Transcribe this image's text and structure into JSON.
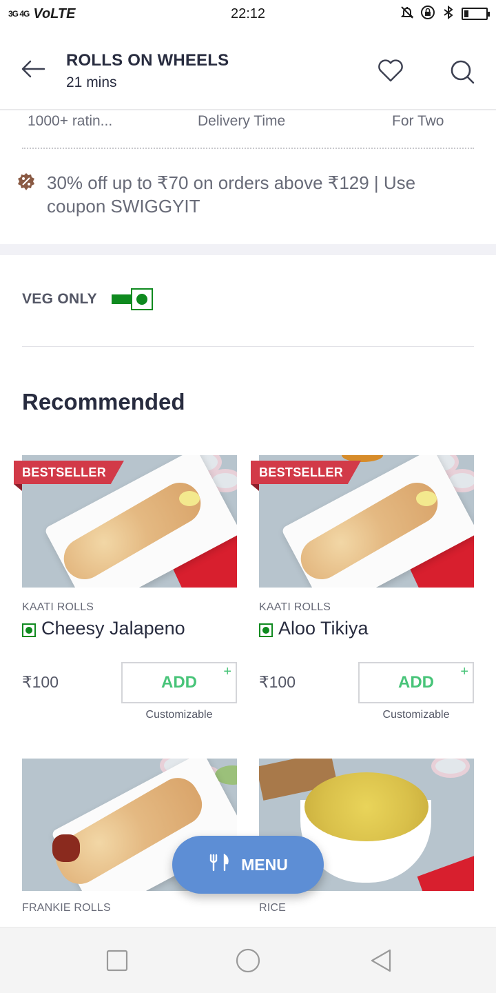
{
  "status_bar": {
    "signal": "3G 4G",
    "network": "VoLTE",
    "time": "22:12",
    "battery_level": 0.2
  },
  "header": {
    "title": "ROLLS ON WHEELS",
    "subtitle": "21 mins"
  },
  "info_row": {
    "rating": "1000+ ratin...",
    "delivery": "Delivery Time",
    "cost": "For Two"
  },
  "offer": {
    "text": "30% off up to ₹70 on orders above ₹129 | Use coupon SWIGGYIT"
  },
  "filters": {
    "veg_only_label": "VEG ONLY",
    "veg_only_on": true
  },
  "section_title": "Recommended",
  "items": [
    {
      "badge": "BESTSELLER",
      "category": "KAATI ROLLS",
      "name": "Cheesy Jalapeno",
      "price": "₹100",
      "add_label": "ADD",
      "add_plus": "+",
      "note": "Customizable"
    },
    {
      "badge": "BESTSELLER",
      "category": "KAATI ROLLS",
      "name": "Aloo Tikiya",
      "price": "₹100",
      "add_label": "ADD",
      "add_plus": "+",
      "note": "Customizable"
    },
    {
      "category": "FRANKIE ROLLS"
    },
    {
      "category": "RICE"
    }
  ],
  "fab": {
    "label": "MENU"
  },
  "colors": {
    "accent_green": "#48c479",
    "veg_green": "#0f8a1f",
    "bestseller_red": "#d23a48",
    "fab_blue": "#5d8ed5"
  }
}
